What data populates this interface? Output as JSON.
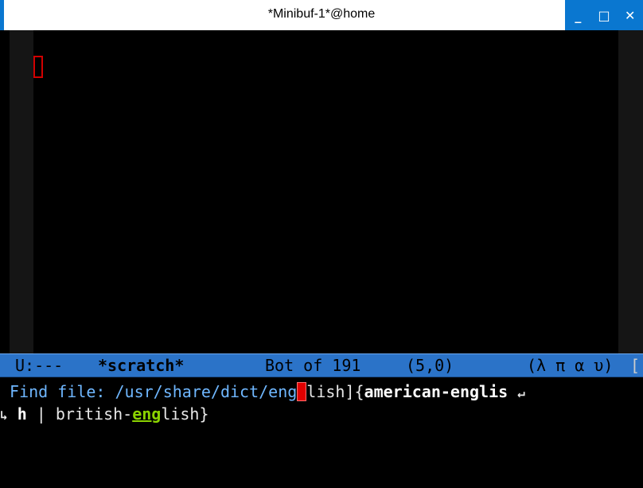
{
  "window": {
    "title": "*Minibuf-1*@home",
    "buttons": {
      "minimize": "_",
      "maximize": "□",
      "close": "✕"
    },
    "accent_color": "#0a77d0"
  },
  "editor": {
    "cursor_color": "#d10000"
  },
  "modeline": {
    "state": "U:---",
    "buffer_name": "*scratch*",
    "position": "Bot of 191",
    "coords": "(5,0)",
    "modes": "(λ π α υ)",
    "overflow": "[",
    "background": "#2b73c8"
  },
  "minibuffer": {
    "prompt": "Find file: ",
    "path_typed": "/usr/share/dict/eng",
    "completion_rest": "lish]",
    "open_brace": "{",
    "candidate1_part1": "american-englis",
    "wrap_right": "↵",
    "wrap_left": "↳",
    "candidate1_part2": "h",
    "separator": " | ",
    "candidate2_prefix": "british-",
    "candidate2_match": "eng",
    "candidate2_suffix": "lish",
    "close_brace": "}"
  }
}
